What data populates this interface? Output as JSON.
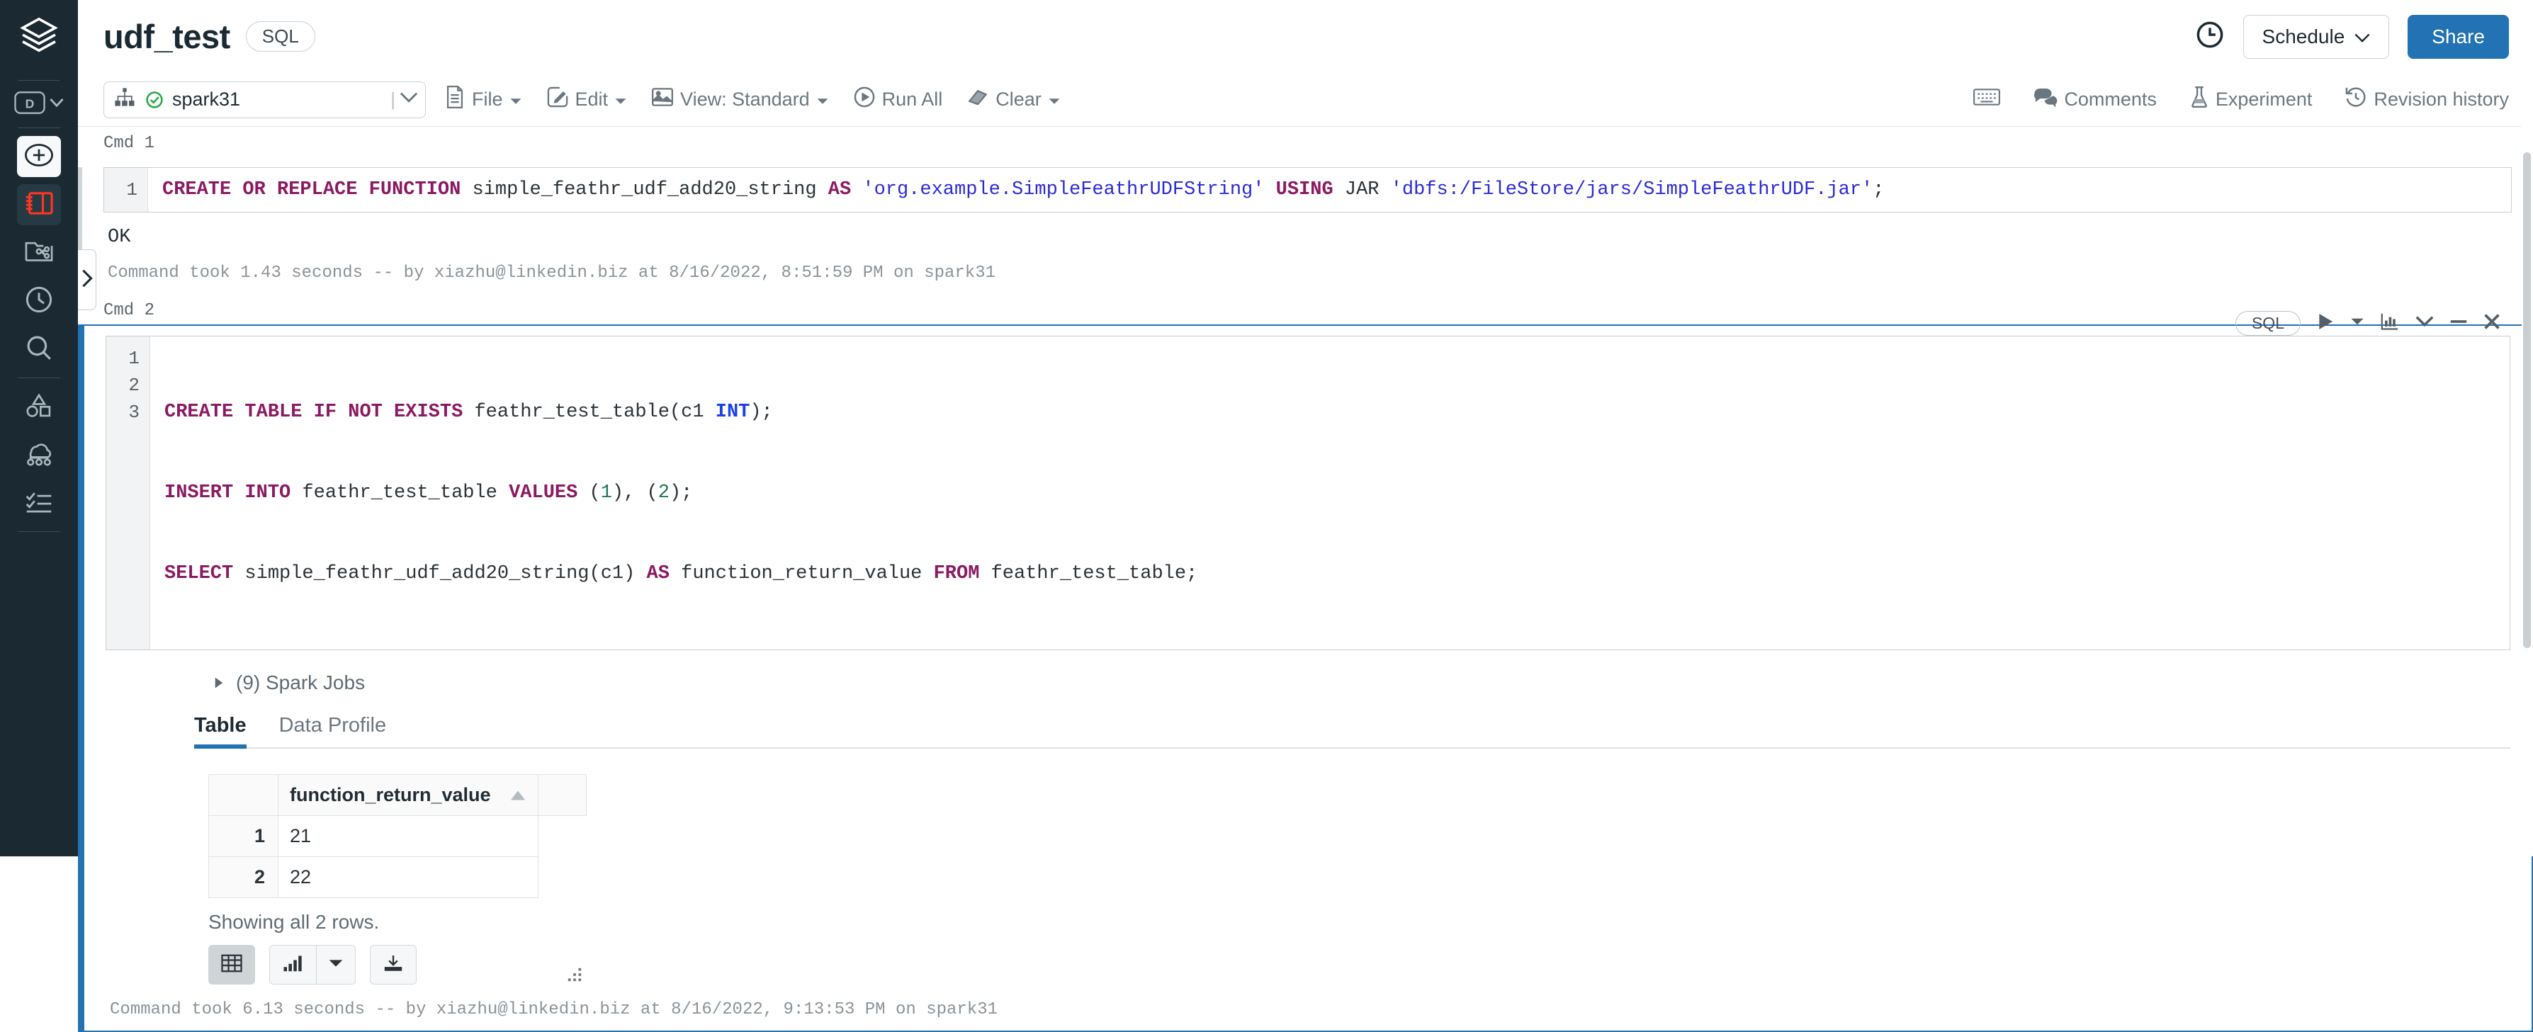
{
  "rail": {
    "logo_icon": "databricks-logo-icon",
    "workspace_label": "D",
    "items": [
      {
        "name": "new-button",
        "icon": "plus-circle-icon"
      },
      {
        "name": "workspace-button",
        "icon": "notebook-icon"
      },
      {
        "name": "repos-button",
        "icon": "repos-folder-icon"
      },
      {
        "name": "recents-button",
        "icon": "clock-icon"
      },
      {
        "name": "search-button",
        "icon": "search-icon"
      },
      {
        "name": "data-button",
        "icon": "shapes-icon"
      },
      {
        "name": "compute-button",
        "icon": "clusters-icon"
      },
      {
        "name": "workflows-button",
        "icon": "checklist-icon"
      }
    ],
    "collapse_icon": "chevron-right-icon"
  },
  "header": {
    "title": "udf_test",
    "language_chip": "SQL",
    "clock_icon": "clock-icon",
    "schedule_label": "Schedule",
    "schedule_caret": "chevron-down-icon",
    "share_label": "Share",
    "share_color": "#2272b4"
  },
  "toolbar": {
    "cluster_icon": "cluster-icon",
    "cluster_status_icon": "status-ok-icon",
    "cluster_name": "spark31",
    "cluster_caret": "chevron-down-icon",
    "items": [
      {
        "label": "File",
        "icon": "file-icon",
        "caret": true
      },
      {
        "label": "Edit",
        "icon": "edit-pencil-icon",
        "caret": true
      },
      {
        "label": "View: Standard",
        "icon": "view-image-icon",
        "caret": true
      },
      {
        "label": "Run All",
        "icon": "play-circle-icon",
        "caret": false
      },
      {
        "label": "Clear",
        "icon": "eraser-icon",
        "caret": true
      }
    ],
    "right_items": [
      {
        "label": "",
        "icon": "keyboard-icon"
      },
      {
        "label": "Comments",
        "icon": "comments-icon"
      },
      {
        "label": "Experiment",
        "icon": "flask-icon"
      },
      {
        "label": "Revision history",
        "icon": "revision-history-icon"
      }
    ]
  },
  "cells": [
    {
      "cmd_label": "Cmd 1",
      "lines": [
        "1"
      ],
      "output": "OK",
      "meta": "Command took 1.43 seconds -- by xiazhu@linkedin.biz at 8/16/2022, 8:51:59 PM on spark31"
    },
    {
      "cmd_label": "Cmd 2",
      "lines": [
        "1",
        "2",
        "3"
      ],
      "language_pill": "SQL",
      "tools": [
        "run-icon",
        "run-caret-icon",
        "chart-icon",
        "chevron-down-icon",
        "minimize-icon",
        "close-icon"
      ],
      "spark_jobs": "(9) Spark Jobs",
      "spark_jobs_caret": "triangle-right-icon",
      "tabs": [
        {
          "label": "Table",
          "selected": true
        },
        {
          "label": "Data Profile",
          "selected": false
        }
      ],
      "table": {
        "columns": [
          "function_return_value"
        ],
        "sort_icon": "sort-asc-icon",
        "rows": [
          {
            "index": "1",
            "values": [
              "21"
            ]
          },
          {
            "index": "2",
            "values": [
              "22"
            ]
          }
        ]
      },
      "rows_note": "Showing all 2 rows.",
      "result_buttons": [
        {
          "name": "table-view-button",
          "icon": "table-grid-icon",
          "active": true
        },
        {
          "name": "chart-view-button",
          "icon": "bar-chart-icon",
          "active": false
        },
        {
          "name": "chart-options-button",
          "icon": "caret-down-icon",
          "active": false
        },
        {
          "name": "download-button",
          "icon": "download-icon",
          "active": false
        }
      ],
      "resize_grip_icon": "resize-grip-icon",
      "meta": "Command took 6.13 seconds -- by xiazhu@linkedin.biz at 8/16/2022, 9:13:53 PM on spark31"
    }
  ],
  "code": {
    "cell1": {
      "line1": [
        {
          "t": "CREATE OR REPLACE FUNCTION",
          "c": "kw"
        },
        {
          "t": " simple_feathr_udf_add20_string ",
          "c": "pl"
        },
        {
          "t": "AS",
          "c": "kw"
        },
        {
          "t": " 'org.example.SimpleFeathrUDFString' ",
          "c": "str"
        },
        {
          "t": "USING",
          "c": "kw"
        },
        {
          "t": " JAR ",
          "c": "pl"
        },
        {
          "t": "'dbfs:/FileStore/jars/SimpleFeathrUDF.jar'",
          "c": "str"
        },
        {
          "t": ";",
          "c": "pl"
        }
      ]
    },
    "cell2": {
      "line1": [
        {
          "t": "CREATE TABLE IF NOT EXISTS",
          "c": "kw"
        },
        {
          "t": " feathr_test_table(c1 ",
          "c": "pl"
        },
        {
          "t": "INT",
          "c": "typ"
        },
        {
          "t": ");",
          "c": "pl"
        }
      ],
      "line2": [
        {
          "t": "INSERT INTO",
          "c": "kw"
        },
        {
          "t": " feathr_test_table ",
          "c": "pl"
        },
        {
          "t": "VALUES",
          "c": "kw"
        },
        {
          "t": " (",
          "c": "pl"
        },
        {
          "t": "1",
          "c": "num"
        },
        {
          "t": "), (",
          "c": "pl"
        },
        {
          "t": "2",
          "c": "num"
        },
        {
          "t": ");",
          "c": "pl"
        }
      ],
      "line3": [
        {
          "t": "SELECT",
          "c": "kw"
        },
        {
          "t": " simple_feathr_udf_add20_string(c1) ",
          "c": "pl"
        },
        {
          "t": "AS",
          "c": "kw"
        },
        {
          "t": " function_return_value ",
          "c": "pl"
        },
        {
          "t": "FROM",
          "c": "kw"
        },
        {
          "t": " feathr_test_table;",
          "c": "pl"
        }
      ]
    }
  }
}
